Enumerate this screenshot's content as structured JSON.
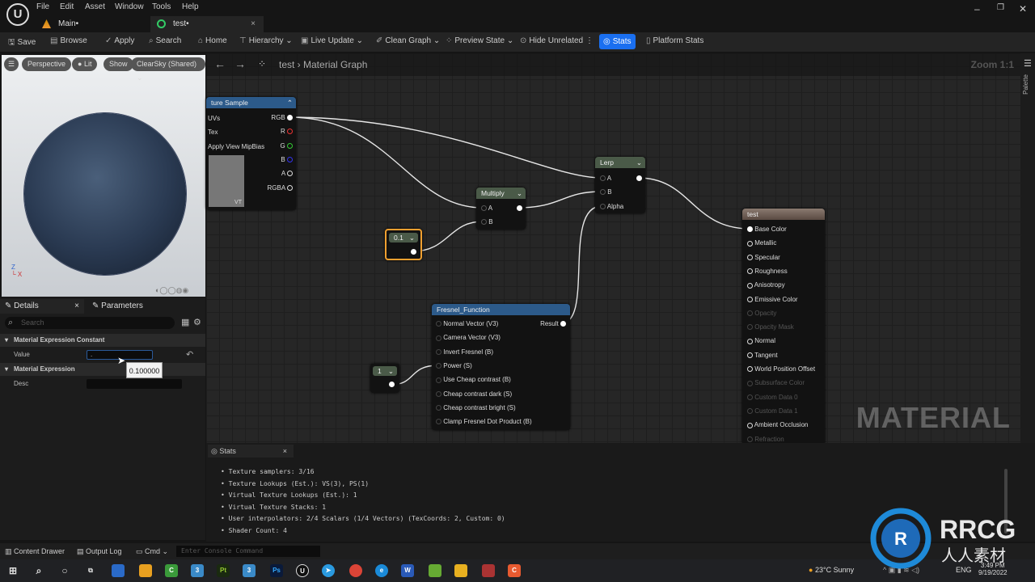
{
  "menu": [
    "File",
    "Edit",
    "Asset",
    "Window",
    "Tools",
    "Help"
  ],
  "tabs": [
    {
      "label": "Main•"
    },
    {
      "label": "test•"
    }
  ],
  "toolbar": {
    "save": "Save",
    "browse": "Browse",
    "apply": "Apply",
    "search": "Search",
    "home": "Home",
    "hierarchy": "Hierarchy",
    "live_update": "Live Update",
    "clean_graph": "Clean Graph",
    "preview_state": "Preview State",
    "hide_unrelated": "Hide Unrelated",
    "stats": "Stats",
    "platform_stats": "Platform Stats"
  },
  "viewport": {
    "perspective": "Perspective",
    "lit": "Lit",
    "show": "Show",
    "sky": "ClearSky (Shared)"
  },
  "graph": {
    "breadcrumb_root": "test",
    "breadcrumb_page": "Material Graph",
    "zoom": "Zoom 1:1",
    "watermark": "MATERIAL",
    "palette": "Palette"
  },
  "details": {
    "tab_details": "Details",
    "tab_parameters": "Parameters",
    "search_placeholder": "Search",
    "cat1": "Material Expression Constant",
    "value_label": "Value",
    "value": ".",
    "tooltip": "0.100000",
    "cat2": "Material Expression",
    "desc_label": "Desc"
  },
  "nodes": {
    "texture": {
      "title": "ture Sample",
      "inputs": [
        "UVs",
        "Tex",
        "Apply View MipBias"
      ],
      "outputs": [
        "RGB",
        "R",
        "G",
        "B",
        "A",
        "RGBA"
      ],
      "vt": "VT"
    },
    "multiply": {
      "title": "Multiply",
      "inputs": [
        "A",
        "B"
      ]
    },
    "lerp": {
      "title": "Lerp",
      "inputs": [
        "A",
        "B",
        "Alpha"
      ]
    },
    "const01": {
      "title": "0.1"
    },
    "const1": {
      "title": "1"
    },
    "fresnel": {
      "title": "Fresnel_Function",
      "inputs": [
        "Normal Vector (V3)",
        "Camera Vector (V3)",
        "Invert Fresnel (B)",
        "Power (S)",
        "Use Cheap contrast (B)",
        "Cheap contrast dark (S)",
        "Cheap contrast bright (S)",
        "Clamp Fresnel Dot Product (B)"
      ],
      "output": "Result"
    },
    "result": {
      "title": "test",
      "inputs": [
        {
          "label": "Base Color",
          "enabled": true
        },
        {
          "label": "Metallic",
          "enabled": true
        },
        {
          "label": "Specular",
          "enabled": true
        },
        {
          "label": "Roughness",
          "enabled": true
        },
        {
          "label": "Anisotropy",
          "enabled": true
        },
        {
          "label": "Emissive Color",
          "enabled": true
        },
        {
          "label": "Opacity",
          "enabled": false
        },
        {
          "label": "Opacity Mask",
          "enabled": false
        },
        {
          "label": "Normal",
          "enabled": true
        },
        {
          "label": "Tangent",
          "enabled": true
        },
        {
          "label": "World Position Offset",
          "enabled": true
        },
        {
          "label": "Subsurface Color",
          "enabled": false
        },
        {
          "label": "Custom Data 0",
          "enabled": false
        },
        {
          "label": "Custom Data 1",
          "enabled": false
        },
        {
          "label": "Ambient Occlusion",
          "enabled": true
        },
        {
          "label": "Refraction",
          "enabled": false
        }
      ]
    }
  },
  "stats": {
    "tab": "Stats",
    "lines": [
      "Texture samplers: 3/16",
      "Texture Lookups (Est.): VS(3), PS(1)",
      "Virtual Texture Lookups (Est.): 1",
      "Virtual Texture Stacks: 1",
      "User interpolators: 2/4 Scalars (1/4 Vectors) (TexCoords: 2, Custom: 0)",
      "Shader Count: 4"
    ]
  },
  "bottom": {
    "content_drawer": "Content Drawer",
    "output_log": "Output Log",
    "cmd": "Cmd",
    "console_placeholder": "Enter Console Command"
  },
  "taskbar": {
    "weather": "23°C  Sunny",
    "lang": "ENG",
    "time": "3:49 PM",
    "date": "9/19/2022"
  },
  "colors": {
    "accent": "#1a6ff0",
    "selected_node": "#f0a030",
    "texture_header": "#2c5a8a",
    "math_header": "#4a5a48",
    "result_header": "#6a5a50"
  }
}
